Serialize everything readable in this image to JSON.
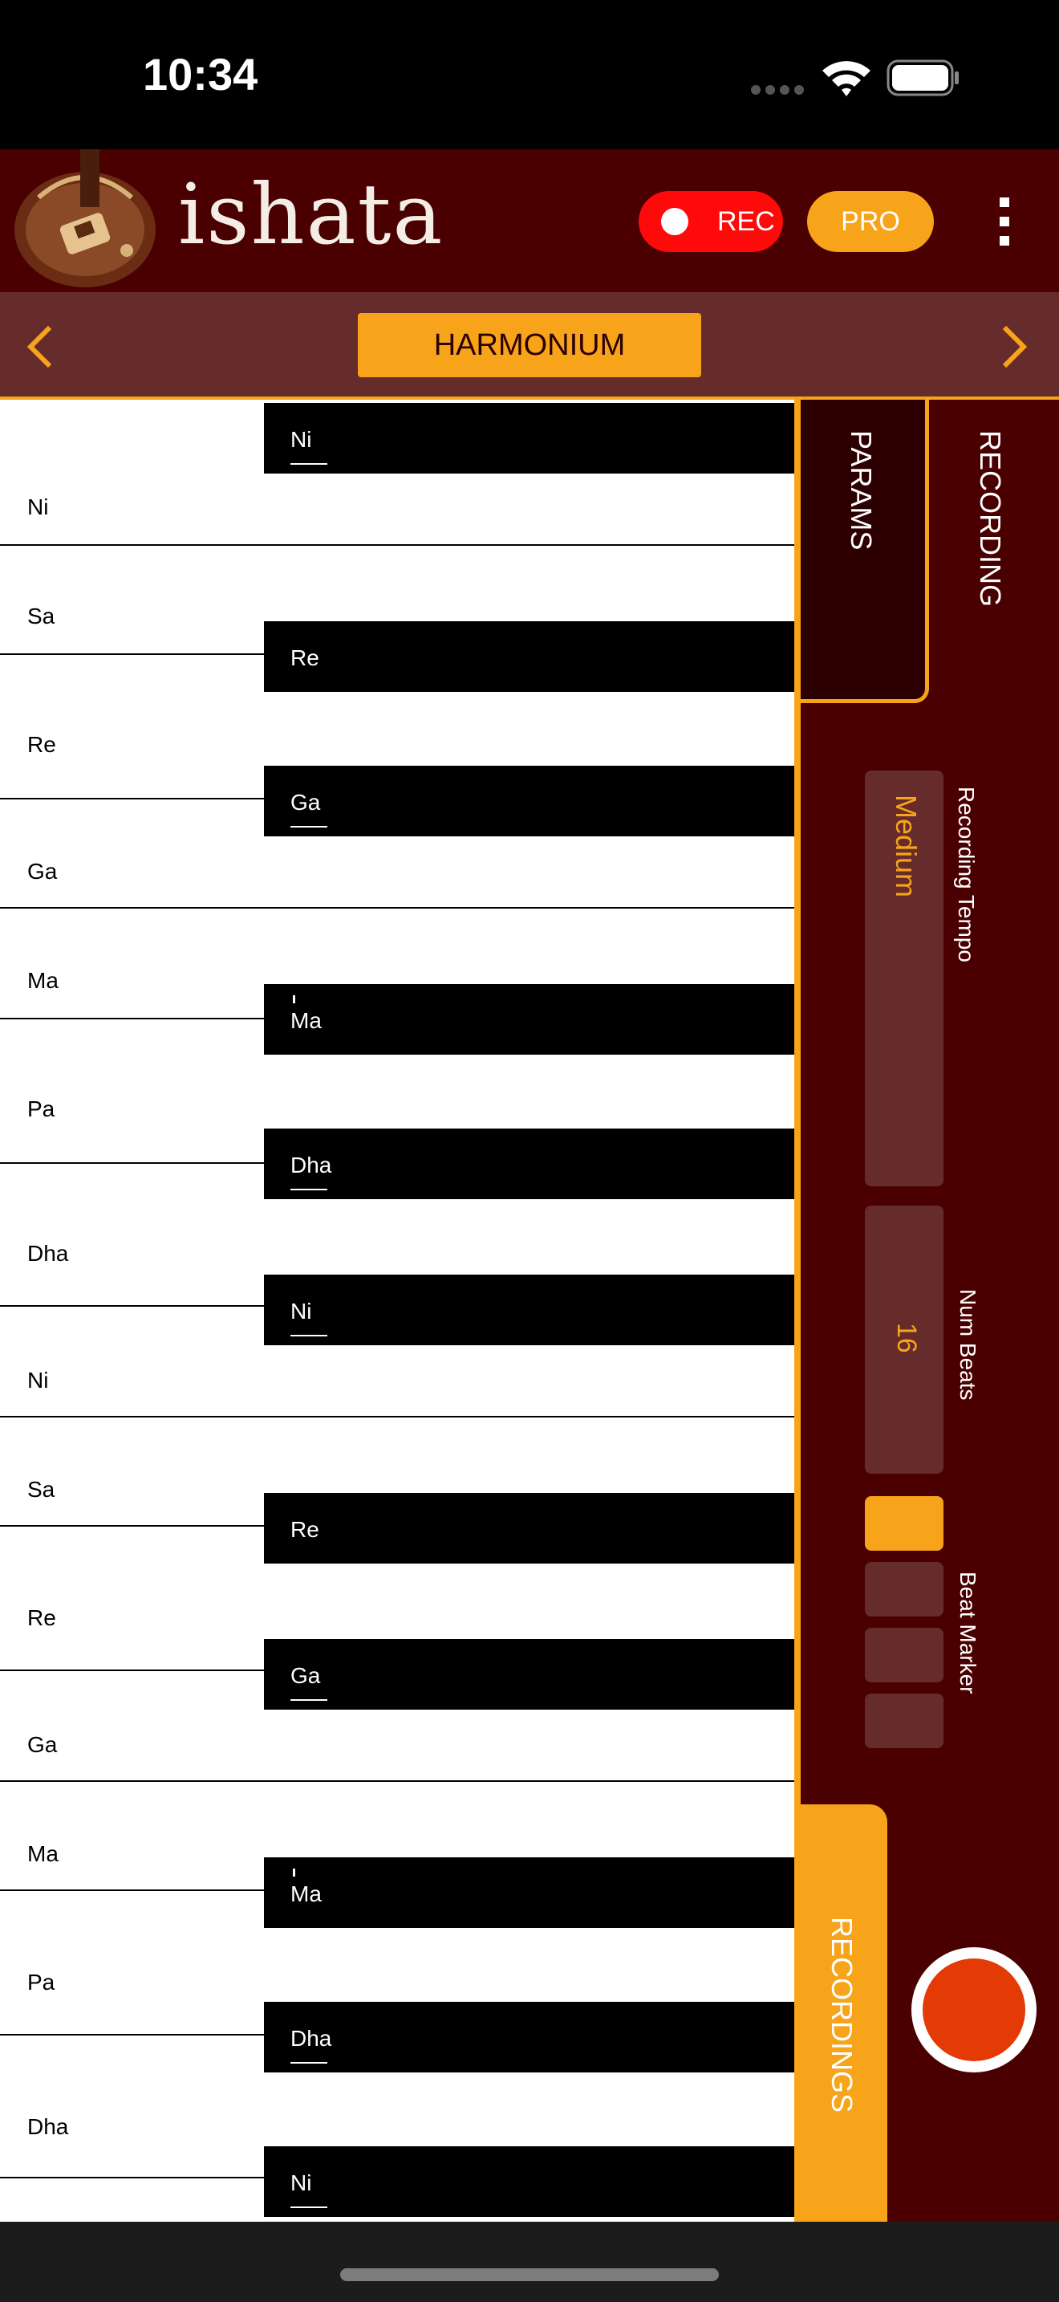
{
  "status_bar": {
    "time": "10:34"
  },
  "header": {
    "brand": "ishata",
    "rec_label": "REC",
    "pro_label": "PRO"
  },
  "instrument_bar": {
    "current": "HARMONIUM"
  },
  "keyboard": {
    "white_keys": [
      "Ni",
      "Sa",
      "Re",
      "Ga",
      "Ma",
      "Pa",
      "Dha",
      "Ni",
      "Sa",
      "Re",
      "Ga",
      "Ma",
      "Pa",
      "Dha"
    ],
    "black_keys": [
      "Ni",
      "Re",
      "Ga",
      "Ma",
      "Dha",
      "Ni",
      "Re",
      "Ga",
      "Ma",
      "Dha",
      "Ni"
    ]
  },
  "panel": {
    "tab_params": "PARAMS",
    "tab_recording": "RECORDING",
    "tempo_label": "Recording Tempo",
    "tempo_value": "Medium",
    "beats_label": "Num Beats",
    "beats_value": "16",
    "marker_label": "Beat Marker",
    "markers_active": [
      true,
      false,
      false,
      false
    ],
    "tab_recordings": "RECORDINGS"
  },
  "colors": {
    "accent": "#f7a41a",
    "header_bg": "#4a0000",
    "bar_bg": "#662c2c",
    "rec_red": "#ff0a0a",
    "record_orange": "#e33a06"
  }
}
